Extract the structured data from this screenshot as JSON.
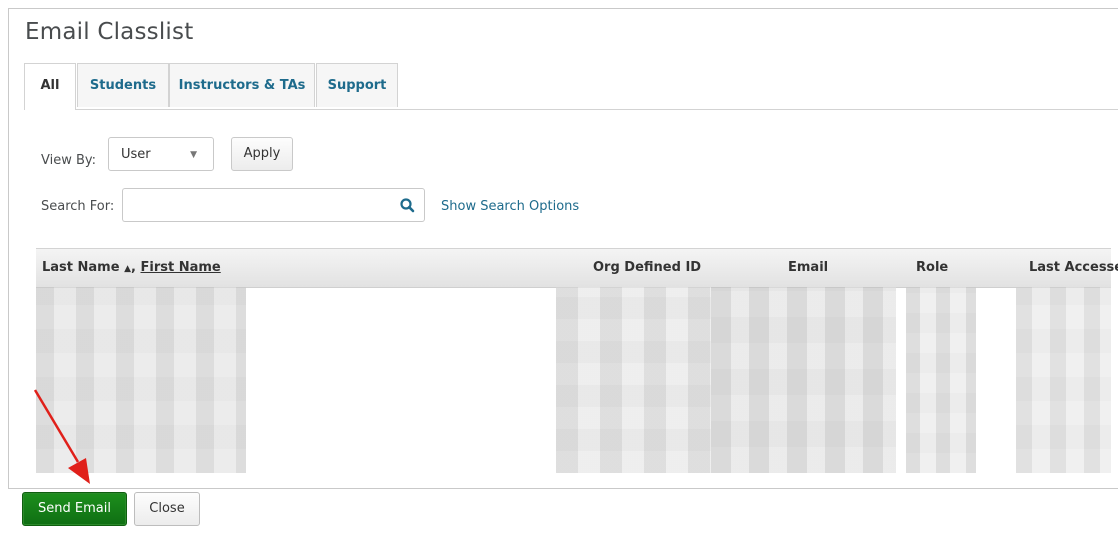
{
  "window": {
    "title": "Email Classlist"
  },
  "tabs": [
    {
      "label": "All",
      "active": true
    },
    {
      "label": "Students",
      "active": false
    },
    {
      "label": "Instructors & TAs",
      "active": false
    },
    {
      "label": "Support",
      "active": false
    }
  ],
  "filters": {
    "view_by_label": "View By:",
    "view_by_value": "User",
    "apply_label": "Apply",
    "search_label": "Search For:",
    "search_value": "",
    "show_search_options": "Show Search Options"
  },
  "table": {
    "col_name_prefix": "Last Name",
    "col_name_sort_glyph": "▲",
    "col_name_sep": ",",
    "col_name_secondary": "First Name",
    "col_org_id": "Org Defined ID",
    "col_email": "Email",
    "col_role": "Role",
    "col_last_accessed": "Last Accessed",
    "rows_obscured": true
  },
  "footer": {
    "send_email_label": "Send Email",
    "close_label": "Close"
  },
  "colors": {
    "link": "#1e6b8c",
    "primary_button": "#1a8a1a",
    "annotation_arrow": "#e0201a"
  },
  "icons": {
    "search": "search-icon",
    "dropdown": "chevron-down-icon",
    "annotation": "red-arrow"
  }
}
